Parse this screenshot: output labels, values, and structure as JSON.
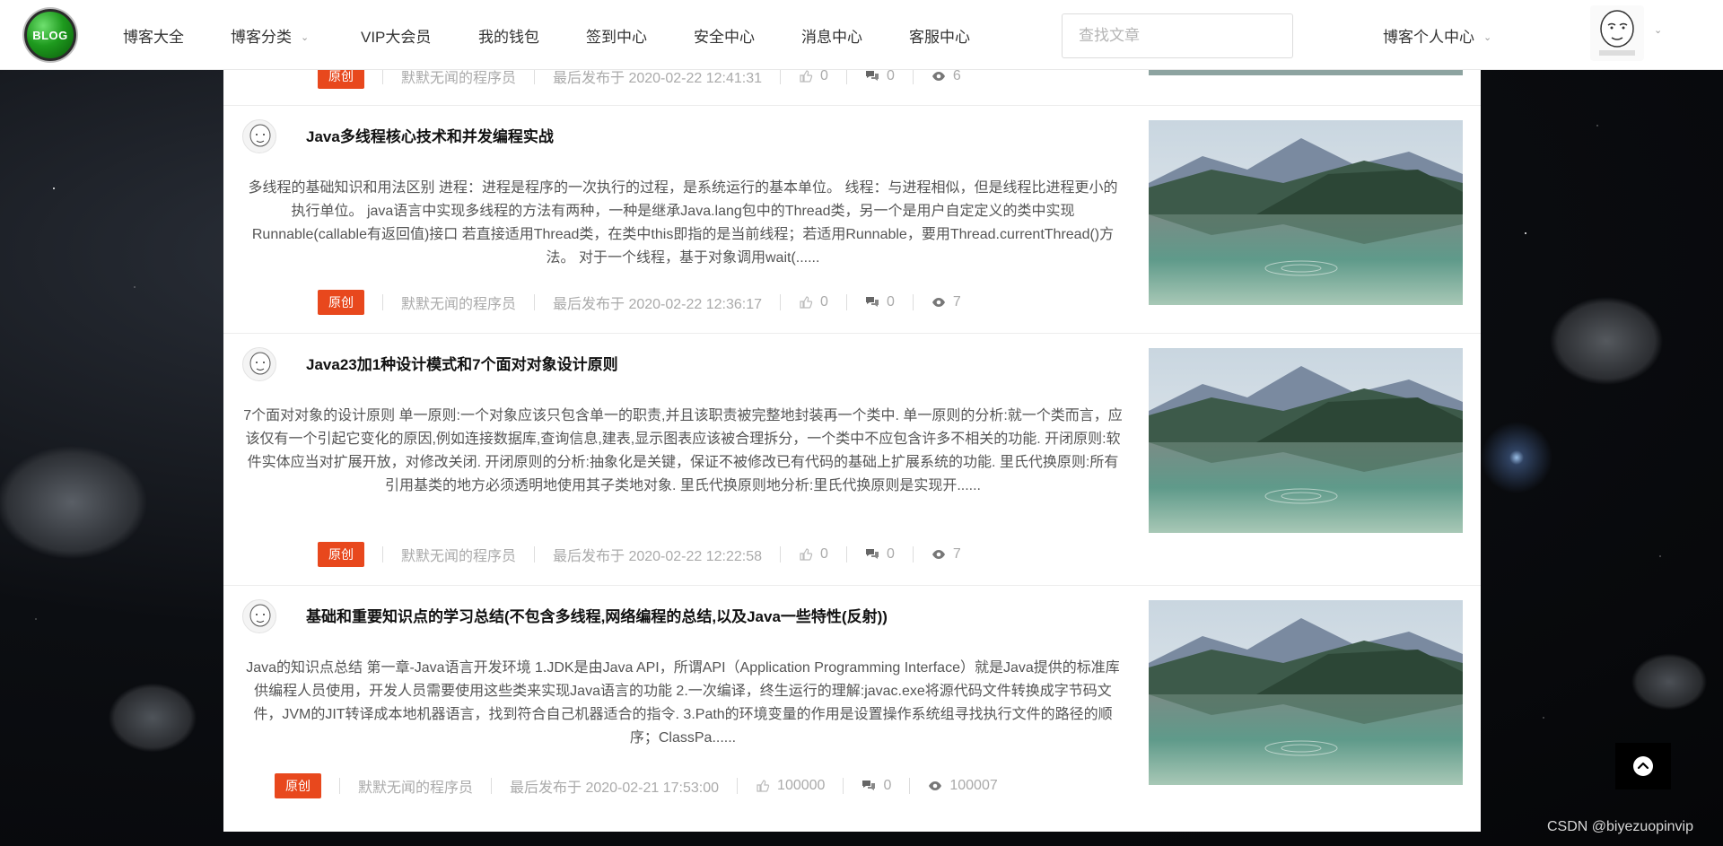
{
  "nav": {
    "logo_text": "BLOG",
    "items": [
      {
        "label": "博客大全"
      },
      {
        "label": "博客分类",
        "dropdown": true
      },
      {
        "label": "VIP大会员"
      },
      {
        "label": "我的钱包"
      },
      {
        "label": "签到中心"
      },
      {
        "label": "安全中心"
      },
      {
        "label": "消息中心"
      },
      {
        "label": "客服中心"
      }
    ],
    "search_placeholder": "查找文章",
    "personal_center": "博客个人中心"
  },
  "articles": [
    {
      "badge": "原创",
      "author": "默默无闻的程序员",
      "published": "最后发布于 2020-02-22 12:41:31",
      "likes": "0",
      "comments": "0",
      "views": "6"
    },
    {
      "title": "Java多线程核心技术和并发编程实战",
      "excerpt": "多线程的基础知识和用法区别 进程：进程是程序的一次执行的过程，是系统运行的基本单位。 线程：与进程相似，但是线程比进程更小的执行单位。 java语言中实现多线程的方法有两种，一种是继承Java.lang包中的Thread类，另一个是用户自定定义的类中实现Runnable(callable有返回值)接口 若直接适用Thread类，在类中this即指的是当前线程；若适用Runnable，要用Thread.currentThread()方法。 对于一个线程，基于对象调用wait(......",
      "badge": "原创",
      "author": "默默无闻的程序员",
      "published": "最后发布于 2020-02-22 12:36:17",
      "likes": "0",
      "comments": "0",
      "views": "7"
    },
    {
      "title": "Java23加1种设计模式和7个面对对象设计原则",
      "excerpt": "7个面对对象的设计原则 单一原则:一个对象应该只包含单一的职责,并且该职责被完整地封装再一个类中. 单一原则的分析:就一个类而言，应该仅有一个引起它变化的原因,例如连接数据库,查询信息,建表,显示图表应该被合理拆分，一个类中不应包含许多不相关的功能. 开闭原则:软件实体应当对扩展开放，对修改关闭. 开闭原则的分析:抽象化是关键，保证不被修改已有代码的基础上扩展系统的功能. 里氏代换原则:所有引用基类的地方必须透明地使用其子类地对象. 里氏代换原则地分析:里氏代换原则是实现开......",
      "badge": "原创",
      "author": "默默无闻的程序员",
      "published": "最后发布于 2020-02-22 12:22:58",
      "likes": "0",
      "comments": "0",
      "views": "7"
    },
    {
      "title": "基础和重要知识点的学习总结(不包含多线程,网络编程的总结,以及Java一些特性(反射))",
      "excerpt": "Java的知识点总结 第一章-Java语言开发环境 1.JDK是由Java API，所谓API（Application Programming Interface）就是Java提供的标准库供编程人员使用，开发人员需要使用这些类来实现Java语言的功能 2.一次编译，终生运行的理解:javac.exe将源代码文件转换成字节码文件，JVM的JIT转译成本地机器语言，找到符合自己机器适合的指令. 3.Path的环境变量的作用是设置操作系统组寻找执行文件的路径的顺序；ClassPa......",
      "badge": "原创",
      "author": "默默无闻的程序员",
      "published": "最后发布于 2020-02-21 17:53:00",
      "likes": "100000",
      "comments": "0",
      "views": "100007"
    }
  ],
  "watermark": "CSDN @biyezuopinvip",
  "colors": {
    "badge": "#e8481d",
    "nav_bg": "#ffffff",
    "panel_bg": "#ffffff",
    "back_top_bg": "#000000"
  },
  "icons": [
    "like-icon",
    "comment-icon",
    "view-icon",
    "chevron-down-icon",
    "arrow-up-icon"
  ]
}
